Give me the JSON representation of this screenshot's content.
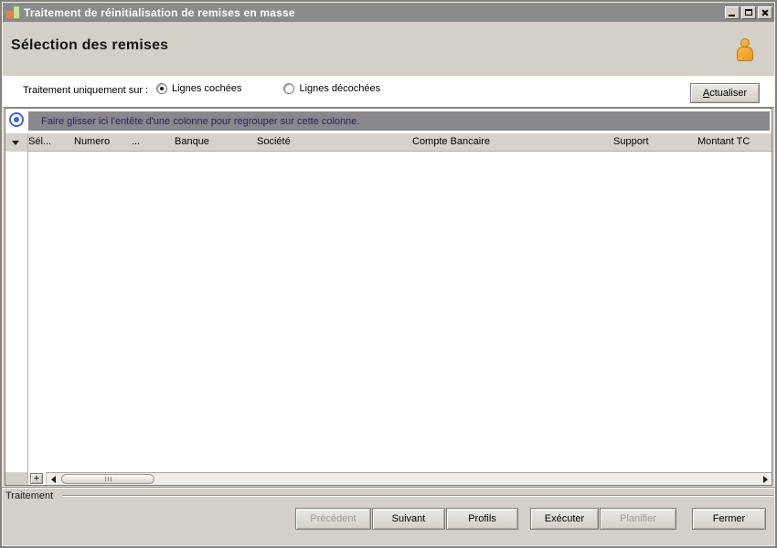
{
  "window": {
    "title": "Traitement de réinitialisation de remises en masse"
  },
  "header": {
    "title": "Sélection des remises"
  },
  "toolbar": {
    "label": "Traitement uniquement sur :",
    "radio_checked_label": "Lignes cochées",
    "radio_unchecked_label": "Lignes décochées",
    "refresh_button": "Actualiser"
  },
  "grid": {
    "group_by_hint": "Faire glisser ici l'entête d'une colonne pour regrouper sur cette colonne.",
    "columns": [
      {
        "label": "Sél..."
      },
      {
        "label": "Numero"
      },
      {
        "label": "..."
      },
      {
        "label": "Banque"
      },
      {
        "label": "Société"
      },
      {
        "label": "Compte Bancaire"
      },
      {
        "label": "Support"
      },
      {
        "label": "Montant TC"
      }
    ],
    "rows": [],
    "add_button": "+"
  },
  "footer": {
    "group_label": "Traitement",
    "buttons": [
      {
        "label": "Précédent",
        "enabled": false
      },
      {
        "label": "Suivant",
        "enabled": true
      },
      {
        "label": "Profils",
        "enabled": true
      },
      {
        "label": "Exécuter",
        "enabled": true
      },
      {
        "label": "Planifier",
        "enabled": false
      },
      {
        "label": "Fermer",
        "enabled": true
      }
    ]
  },
  "colors": {
    "window_background": "#d4d0c8",
    "titlebar": "#8b8b8b",
    "group_bar": "#8a878d",
    "group_bar_text": "#24265f",
    "header_row": "#d6d2ca",
    "accent_person_icon": "#eda32a",
    "accent_target_icon": "#3f66c4"
  }
}
